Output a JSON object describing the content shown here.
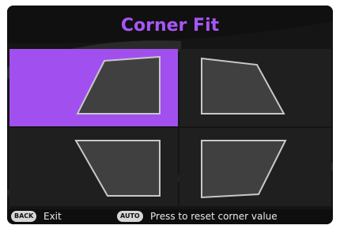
{
  "window": {
    "title": "Corner Fit"
  },
  "corners": [
    {
      "id": "top-left",
      "selected": true
    },
    {
      "id": "top-right",
      "selected": false
    },
    {
      "id": "bottom-left",
      "selected": false
    },
    {
      "id": "bottom-right",
      "selected": false
    }
  ],
  "footer": {
    "back_key": "BACK",
    "back_label": "Exit",
    "auto_key": "AUTO",
    "auto_label": "Press to reset corner value"
  },
  "colors": {
    "accent": "#a24ff0",
    "title": "#a855f7",
    "shape_fill": "#404040",
    "shape_stroke": "#c8c8c8"
  }
}
